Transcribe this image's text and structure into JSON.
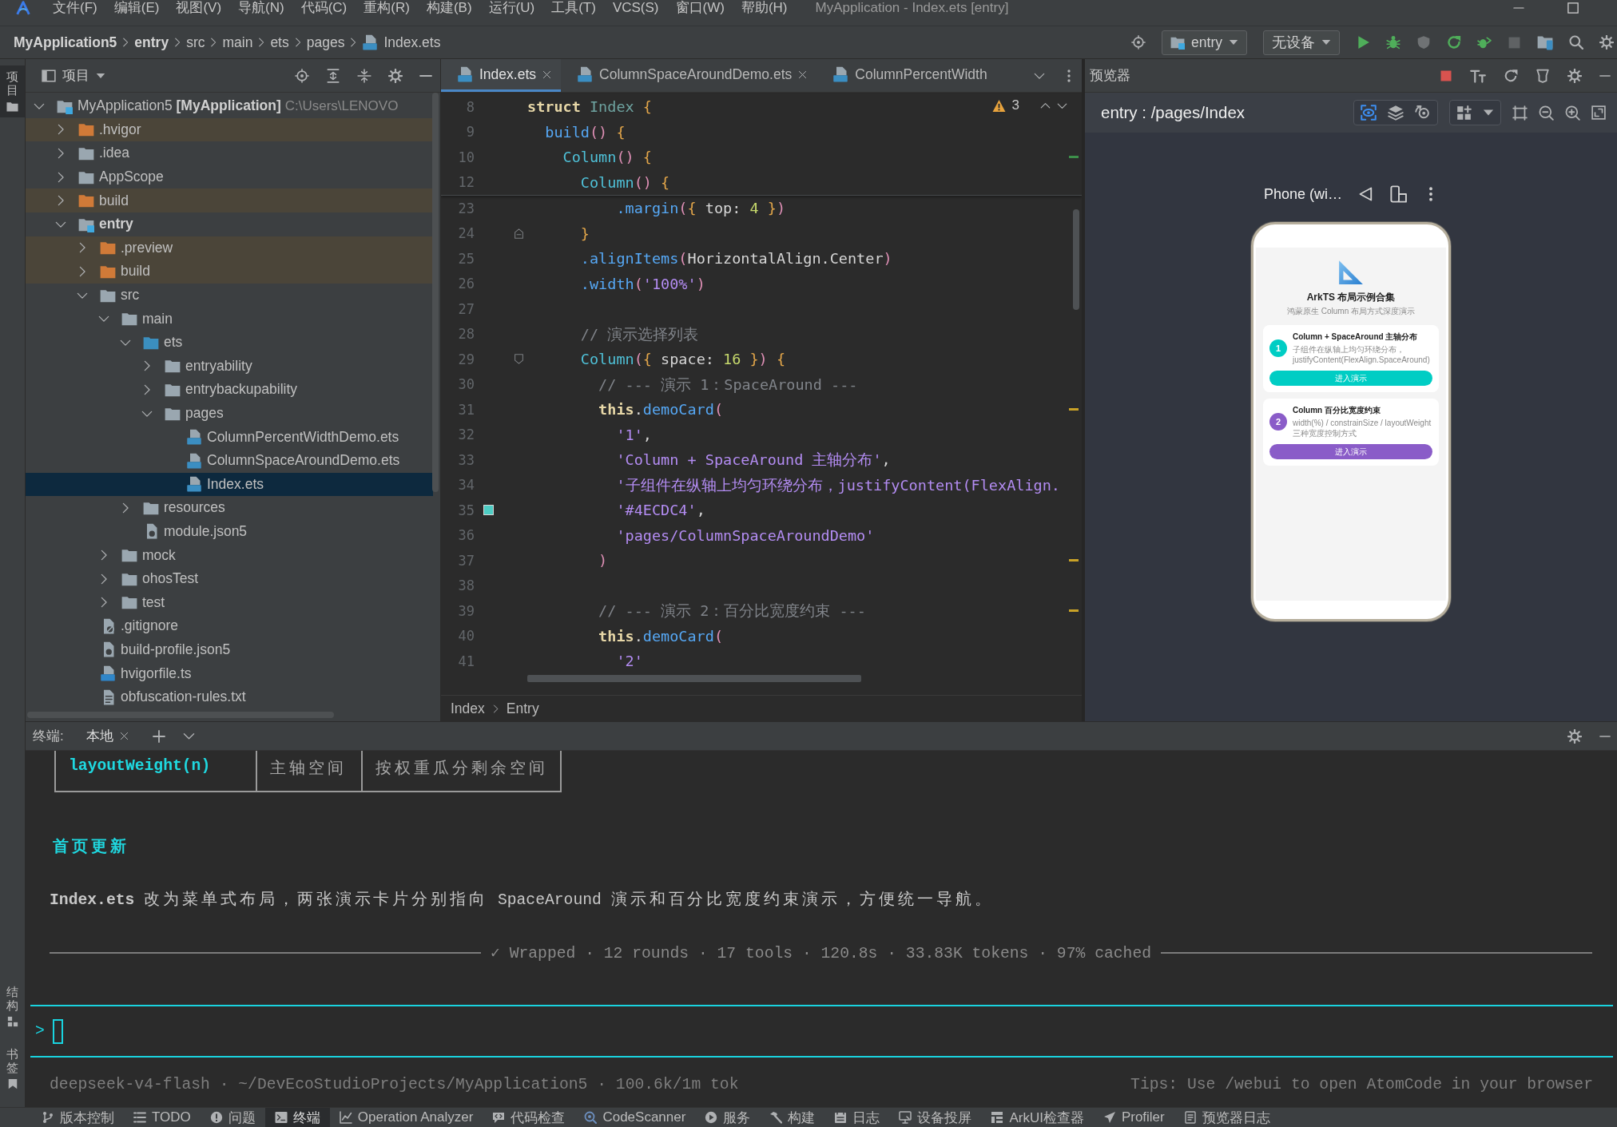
{
  "menu_bar": {
    "menus": [
      "文件(F)",
      "编辑(E)",
      "视图(V)",
      "导航(N)",
      "代码(C)",
      "重构(R)",
      "构建(B)",
      "运行(U)",
      "工具(T)",
      "VCS(S)",
      "窗口(W)",
      "帮助(H)"
    ],
    "window_title": "MyApplication - Index.ets [entry]"
  },
  "navigation_bar": {
    "breadcrumbs": [
      {
        "label": "MyApplication5",
        "kind": "project"
      },
      {
        "label": "entry",
        "kind": "module"
      },
      {
        "label": "src",
        "kind": "folder"
      },
      {
        "label": "main",
        "kind": "folder"
      },
      {
        "label": "ets",
        "kind": "folder"
      },
      {
        "label": "pages",
        "kind": "folder"
      },
      {
        "label": "Index.ets",
        "kind": "file"
      }
    ],
    "run_configuration": "entry",
    "device": "无设备"
  },
  "tool_stripe": {
    "top_tabs": [
      {
        "label": "项目",
        "selected": true
      }
    ],
    "bottom_tabs": [
      {
        "label": "结构",
        "selected": false
      },
      {
        "label": "书签",
        "selected": false
      }
    ]
  },
  "project_panel": {
    "title": "项目",
    "tree": [
      {
        "name": "MyApplication5",
        "kind": "project",
        "suffix": "[MyApplication]",
        "path": "C:\\Users\\LENOVO",
        "expanded": true,
        "selected": false,
        "children": [
          {
            "name": ".hvigor",
            "kind": "excluded",
            "expanded": false,
            "selected": false
          },
          {
            "name": ".idea",
            "kind": "folder",
            "expanded": false,
            "selected": false
          },
          {
            "name": "AppScope",
            "kind": "folder",
            "expanded": false,
            "selected": false
          },
          {
            "name": "build",
            "kind": "excluded",
            "expanded": false,
            "selected": false
          },
          {
            "name": "entry",
            "kind": "module",
            "expanded": true,
            "selected": false,
            "children": [
              {
                "name": ".preview",
                "kind": "excluded",
                "expanded": false,
                "selected": false
              },
              {
                "name": "build",
                "kind": "excluded",
                "expanded": false,
                "selected": false
              },
              {
                "name": "src",
                "kind": "folder",
                "expanded": true,
                "selected": false,
                "children": [
                  {
                    "name": "main",
                    "kind": "folder",
                    "expanded": true,
                    "selected": false,
                    "children": [
                      {
                        "name": "ets",
                        "kind": "source",
                        "expanded": true,
                        "selected": false,
                        "children": [
                          {
                            "name": "entryability",
                            "kind": "folder",
                            "expanded": false,
                            "selected": false
                          },
                          {
                            "name": "entrybackupability",
                            "kind": "folder",
                            "expanded": false,
                            "selected": false
                          },
                          {
                            "name": "pages",
                            "kind": "folder",
                            "expanded": true,
                            "selected": false,
                            "children": [
                              {
                                "name": "ColumnPercentWidthDemo.ets",
                                "kind": "ets",
                                "selected": false
                              },
                              {
                                "name": "ColumnSpaceAroundDemo.ets",
                                "kind": "ets",
                                "selected": false
                              },
                              {
                                "name": "Index.ets",
                                "kind": "ets",
                                "selected": true
                              }
                            ]
                          }
                        ]
                      },
                      {
                        "name": "resources",
                        "kind": "folder",
                        "expanded": false,
                        "selected": false
                      },
                      {
                        "name": "module.json5",
                        "kind": "json",
                        "selected": false
                      }
                    ]
                  },
                  {
                    "name": "mock",
                    "kind": "folder",
                    "expanded": false,
                    "selected": false
                  },
                  {
                    "name": "ohosTest",
                    "kind": "folder",
                    "expanded": false,
                    "selected": false
                  },
                  {
                    "name": "test",
                    "kind": "folder",
                    "expanded": false,
                    "selected": false
                  }
                ]
              },
              {
                "name": ".gitignore",
                "kind": "ignore",
                "selected": false
              },
              {
                "name": "build-profile.json5",
                "kind": "json",
                "selected": false
              },
              {
                "name": "hvigorfile.ts",
                "kind": "ts",
                "selected": false
              },
              {
                "name": "obfuscation-rules.txt",
                "kind": "text",
                "selected": false
              }
            ]
          }
        ]
      }
    ]
  },
  "editor": {
    "tabs": [
      {
        "label": "Index.ets",
        "selected": true,
        "closable": true
      },
      {
        "label": "ColumnSpaceAroundDemo.ets",
        "selected": false,
        "closable": true
      },
      {
        "label": "ColumnPercentWidth",
        "selected": false,
        "closable": false
      }
    ],
    "warning_count": "3",
    "sticky_lines": [
      {
        "number": "8",
        "kind": "code",
        "tokens": [
          {
            "kind": "keyword",
            "text": "struct"
          },
          {
            "kind": "type",
            "text": " Index"
          },
          {
            "kind": "brace",
            "text": " {"
          }
        ]
      },
      {
        "number": "9",
        "kind": "code",
        "tokens": [
          {
            "kind": "function",
            "text": "  build"
          },
          {
            "kind": "paren",
            "text": "()"
          },
          {
            "kind": "brace",
            "text": " {"
          }
        ]
      },
      {
        "number": "10",
        "kind": "change",
        "tokens": [
          {
            "kind": "component",
            "text": "    Column"
          },
          {
            "kind": "paren",
            "text": "()"
          },
          {
            "kind": "brace",
            "text": " {"
          }
        ]
      },
      {
        "number": "12",
        "kind": "code",
        "tokens": [
          {
            "kind": "component",
            "text": "      Column"
          },
          {
            "kind": "paren",
            "text": "()"
          },
          {
            "kind": "brace",
            "text": " {"
          }
        ]
      }
    ],
    "lines": [
      {
        "number": "23",
        "kind": "code",
        "tokens": [
          {
            "kind": "function",
            "text": "          .margin"
          },
          {
            "kind": "paren",
            "text": "("
          },
          {
            "kind": "brace",
            "text": "{"
          },
          {
            "kind": "plain",
            "text": " top: "
          },
          {
            "kind": "number",
            "text": "4"
          },
          {
            "kind": "brace",
            "text": " }"
          },
          {
            "kind": "paren",
            "text": ")"
          }
        ]
      },
      {
        "number": "24",
        "kind": "fold-end",
        "tokens": [
          {
            "kind": "brace",
            "text": "      }"
          }
        ]
      },
      {
        "number": "25",
        "kind": "code",
        "tokens": [
          {
            "kind": "function",
            "text": "      .alignItems"
          },
          {
            "kind": "paren",
            "text": "("
          },
          {
            "kind": "plain",
            "text": "HorizontalAlign.Center"
          },
          {
            "kind": "paren",
            "text": ")"
          }
        ]
      },
      {
        "number": "26",
        "kind": "code",
        "tokens": [
          {
            "kind": "function",
            "text": "      .width"
          },
          {
            "kind": "paren",
            "text": "("
          },
          {
            "kind": "string",
            "text": "'100%'"
          },
          {
            "kind": "paren",
            "text": ")"
          }
        ]
      },
      {
        "number": "27",
        "kind": "code"
      },
      {
        "number": "28",
        "kind": "code",
        "tokens": [
          {
            "kind": "comment",
            "text": "      // 演示选择列表"
          }
        ]
      },
      {
        "number": "29",
        "kind": "fold-start",
        "tokens": [
          {
            "kind": "component",
            "text": "      Column"
          },
          {
            "kind": "paren",
            "text": "("
          },
          {
            "kind": "brace",
            "text": "{"
          },
          {
            "kind": "plain",
            "text": " space: "
          },
          {
            "kind": "number",
            "text": "16"
          },
          {
            "kind": "brace",
            "text": " }"
          },
          {
            "kind": "paren",
            "text": ")"
          },
          {
            "kind": "brace",
            "text": " {"
          }
        ]
      },
      {
        "number": "30",
        "kind": "code",
        "tokens": [
          {
            "kind": "comment",
            "text": "        // --- 演示 1：SpaceAround ---"
          }
        ]
      },
      {
        "number": "31",
        "kind": "warning",
        "tokens": [
          {
            "kind": "keyword",
            "text": "        this"
          },
          {
            "kind": "plain",
            "text": "."
          },
          {
            "kind": "function",
            "text": "demoCard"
          },
          {
            "kind": "paren",
            "text": "("
          }
        ]
      },
      {
        "number": "32",
        "kind": "code",
        "tokens": [
          {
            "kind": "string",
            "text": "          '1'"
          },
          {
            "kind": "plain",
            "text": ","
          }
        ]
      },
      {
        "number": "33",
        "kind": "code",
        "tokens": [
          {
            "kind": "string",
            "text": "          'Column + SpaceAround 主轴分布'"
          },
          {
            "kind": "plain",
            "text": ","
          }
        ]
      },
      {
        "number": "34",
        "kind": "code",
        "tokens": [
          {
            "kind": "string",
            "text": "          '子组件在纵轴上均匀环绕分布，justifyContent(FlexAlign."
          }
        ]
      },
      {
        "number": "35",
        "kind": "code",
        "color": "#4ecdc4",
        "tokens": [
          {
            "kind": "string",
            "text": "          '#4ECDC4'"
          },
          {
            "kind": "plain",
            "text": ","
          }
        ]
      },
      {
        "number": "36",
        "kind": "code",
        "tokens": [
          {
            "kind": "string",
            "text": "          'pages/ColumnSpaceAroundDemo'"
          }
        ]
      },
      {
        "number": "37",
        "kind": "warning",
        "tokens": [
          {
            "kind": "paren",
            "text": "        )"
          }
        ]
      },
      {
        "number": "38",
        "kind": "code"
      },
      {
        "number": "39",
        "kind": "warning",
        "tokens": [
          {
            "kind": "comment",
            "text": "        // --- 演示 2：百分比宽度约束 ---"
          }
        ]
      },
      {
        "number": "40",
        "kind": "code",
        "tokens": [
          {
            "kind": "keyword",
            "text": "        this"
          },
          {
            "kind": "plain",
            "text": "."
          },
          {
            "kind": "function",
            "text": "demoCard"
          },
          {
            "kind": "paren",
            "text": "("
          }
        ]
      },
      {
        "number": "41",
        "kind": "code",
        "tokens": [
          {
            "kind": "string",
            "text": "          '2'"
          }
        ]
      }
    ],
    "breadcrumbs": [
      "Index",
      "Entry"
    ]
  },
  "preview": {
    "title": "预览器",
    "route": "entry : /pages/Index",
    "device": "Phone (wi…",
    "app": {
      "title": "ArkTS 布局示例合集",
      "subtitle": "鸿蒙原生 Column 布局方式深度演示",
      "cards": [
        {
          "badge": "1",
          "title": "Column + SpaceAround 主轴分布",
          "description": "子组件在纵轴上均匀环绕分布，justifyContent(FlexAlign.SpaceAround)",
          "button": "进入演示",
          "color": "#00cdc4"
        },
        {
          "badge": "2",
          "title": "Column 百分比宽度约束",
          "description": "width(%) / constrainSize / layoutWeight 三种宽度控制方式",
          "button": "进入演示",
          "color": "#8a5cc8"
        }
      ]
    }
  },
  "terminal": {
    "label": "终端:",
    "tabs": [
      {
        "label": "本地",
        "selected": true
      }
    ],
    "table_row": [
      "layoutWeight(n)",
      "主轴空间",
      "按权重瓜分剩余空间"
    ],
    "heading": "首页更新",
    "summary": "**Index.ets** 改为菜单式布局，两张演示卡片分别指向 SpaceAround 演示和百分比宽度约束演示，方便统一导航。",
    "status": "✓ Wrapped · 12 rounds · 17 tools · 120.8s · 33.83K tokens · 97% cached",
    "prompt": ">",
    "model_info": "deepseek-v4-flash · ~/DevEcoStudioProjects/MyApplication5 · 100.6k/1m tok",
    "tips": "Tips: Use /webui to open AtomCode in your browser"
  },
  "tool_window_bar": {
    "items": [
      {
        "label": "版本控制",
        "selected": false
      },
      {
        "label": "TODO",
        "selected": false
      },
      {
        "label": "问题",
        "selected": false
      },
      {
        "label": "终端",
        "selected": true
      },
      {
        "label": "Operation Analyzer",
        "selected": false
      },
      {
        "label": "代码检查",
        "selected": false
      },
      {
        "label": "CodeScanner",
        "selected": false
      },
      {
        "label": "服务",
        "selected": false
      },
      {
        "label": "构建",
        "selected": false
      },
      {
        "label": "日志",
        "selected": false
      },
      {
        "label": "设备投屏",
        "selected": false
      },
      {
        "label": "ArkUI检查器",
        "selected": false
      },
      {
        "label": "Profiler",
        "selected": false
      },
      {
        "label": "预览器日志",
        "selected": false
      }
    ]
  }
}
